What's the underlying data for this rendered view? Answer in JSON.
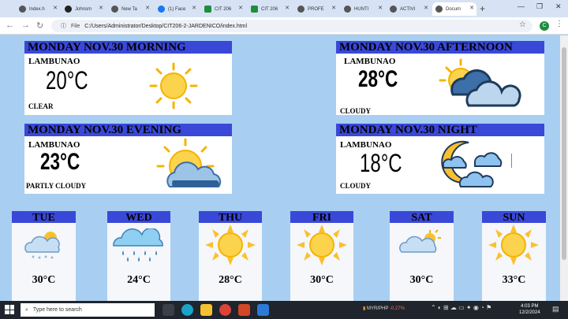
{
  "browser": {
    "tabs": [
      {
        "label": "Index.h",
        "color": "#555555",
        "active": false
      },
      {
        "label": "Johnsm",
        "color": "#222222",
        "active": false
      },
      {
        "label": "New Ta",
        "color": "#555555",
        "active": false
      },
      {
        "label": "(1) Face",
        "color": "#1877f2",
        "active": false
      },
      {
        "label": "CIT 206",
        "color": "#1e8e3e",
        "active": false
      },
      {
        "label": "CIT 206",
        "color": "#1e8e3e",
        "active": false
      },
      {
        "label": "PROFE",
        "color": "#555555",
        "active": false
      },
      {
        "label": "HUNTI",
        "color": "#555555",
        "active": false
      },
      {
        "label": "ACTIVI",
        "color": "#555555",
        "active": false
      },
      {
        "label": "Docum",
        "color": "#555555",
        "active": true
      }
    ],
    "new_tab": "+",
    "url_label": "File",
    "url": "C:/Users/Administrator/Desktop/CIT206-2-JARDENICO/index.html",
    "profile_initial": "C"
  },
  "periods": [
    {
      "title": "MONDAY NOV.30 MORNING",
      "location": "LAMBUNAO",
      "temp": "20°C",
      "condition": "CLEAR",
      "icon": "sun-icon"
    },
    {
      "title": "MONDAY NOV.30 AFTERNOON",
      "location": "LAMBUNAO",
      "temp": "28°C",
      "condition": "CLOUDY",
      "icon": "cloudy-icon"
    },
    {
      "title": "MONDAY NOV.30 EVENING",
      "location": "LAMBUNAO",
      "temp": "23°C",
      "condition": "PARTLY CLOUDY",
      "icon": "partly-cloudy-icon"
    },
    {
      "title": "MONDAY NOV.30 NIGHT",
      "location": "LAMBUNAO",
      "temp": "18°C",
      "condition": "CLOUDY",
      "icon": "moon-cloud-icon"
    }
  ],
  "forecast": [
    {
      "day": "TUE",
      "temp": "30°C",
      "icon": "snow-cloud-icon"
    },
    {
      "day": "WED",
      "temp": "24°C",
      "icon": "rain-cloud-icon"
    },
    {
      "day": "THU",
      "temp": "28°C",
      "icon": "sun-icon"
    },
    {
      "day": "FRI",
      "temp": "30°C",
      "icon": "sun-icon"
    },
    {
      "day": "SAT",
      "temp": "30°C",
      "icon": "sun-cloud-icon"
    },
    {
      "day": "SUN",
      "temp": "33°C",
      "icon": "sun-icon"
    }
  ],
  "taskbar": {
    "search_placeholder": "Type here to search",
    "ticker": "MYR/PHP",
    "ticker_change": "-0.27%",
    "time": "4:03 PM",
    "date": "12/2/2024"
  },
  "colors": {
    "header": "#3a48d8",
    "page": "#a8cff2"
  }
}
